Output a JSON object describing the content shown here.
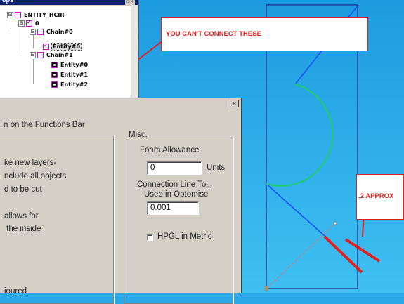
{
  "tree": {
    "title": "ops",
    "title_button": "□ ×",
    "nodes": [
      {
        "label": "ENTITY_HCIR",
        "expander": "⊟",
        "box": "plain"
      },
      {
        "label": "0",
        "expander": "⊟",
        "box": "checked"
      },
      {
        "label": "Chain#0",
        "expander": "⊟",
        "box": "plain"
      },
      {
        "label": "Entity#0",
        "expander": "",
        "box": "checked",
        "selected": true
      },
      {
        "label": "Chain#1",
        "expander": "⊟",
        "box": "plain"
      },
      {
        "label": "Entity#0",
        "expander": "",
        "box": "dot"
      },
      {
        "label": "Entity#1",
        "expander": "",
        "box": "dot"
      },
      {
        "label": "Entity#2",
        "expander": "",
        "box": "dot"
      }
    ]
  },
  "annotations": {
    "callout_text": "YOU CAN'T CONNECT THESE",
    "approx_text": ".2 APPROX",
    "annotation_color": "#e0201f"
  },
  "dialog": {
    "close_label": "×",
    "header_line": "n on the Functions Bar",
    "left_lines": [
      "ke new layers-",
      "nclude all objects",
      "d to be cut",
      "allows for",
      " the inside",
      "ioured"
    ],
    "misc": {
      "legend": "Misc.",
      "foam_label": "Foam Allowance",
      "foam_value": "0",
      "foam_units": "Units",
      "connection_label_1": "Connection Line Tol.",
      "connection_label_2": "Used in Optomise",
      "connection_value": "0.001",
      "hpgl_label": "HPGL in Metric",
      "hpgl_checked": false
    }
  },
  "colors": {
    "canvas_top": "#1d9be0",
    "canvas_bottom": "#38b9f0",
    "outline": "#1a2a8a",
    "arc": "#22cc66",
    "blue_line": "#0a3cff",
    "dialog_bg": "#d4d0c8"
  }
}
